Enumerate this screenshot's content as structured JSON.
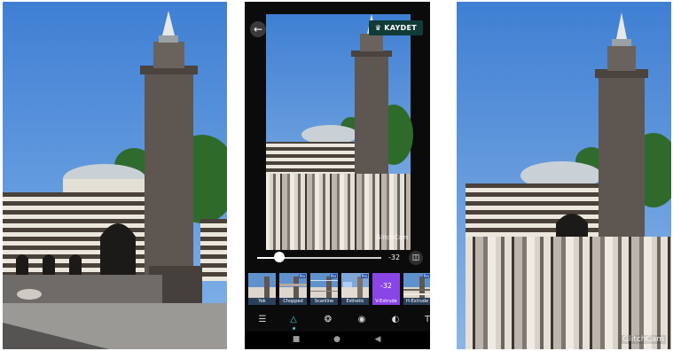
{
  "phone": {
    "save_label": "KAYDET",
    "watermark": "GlitchCam",
    "slider_value_label": "-32",
    "slider_level": 0.18,
    "filters": [
      {
        "label": "Yok",
        "pro": false,
        "active": false
      },
      {
        "label": "Chopped",
        "pro": true,
        "active": false
      },
      {
        "label": "Scanline",
        "pro": true,
        "active": false
      },
      {
        "label": "Esthetic",
        "pro": true,
        "active": false
      },
      {
        "label": "V-Extrude",
        "pro": false,
        "active": true,
        "value": "-32"
      },
      {
        "label": "H-Extrude",
        "pro": true,
        "active": false
      }
    ],
    "pro_badge": "Pro",
    "tools": [
      "adjust-icon",
      "triangle-icon",
      "overlap-circles-icon",
      "ball-icon",
      "pill-icon",
      "text-icon"
    ],
    "active_tool": 1,
    "nav": [
      "recents-icon",
      "home-icon",
      "back-nav-icon"
    ]
  },
  "right": {
    "watermark": "GlitchCam"
  },
  "colors": {
    "accent": "#3fd0c8",
    "save_bg": "#103b36",
    "active_filter": "#8a45e6"
  }
}
